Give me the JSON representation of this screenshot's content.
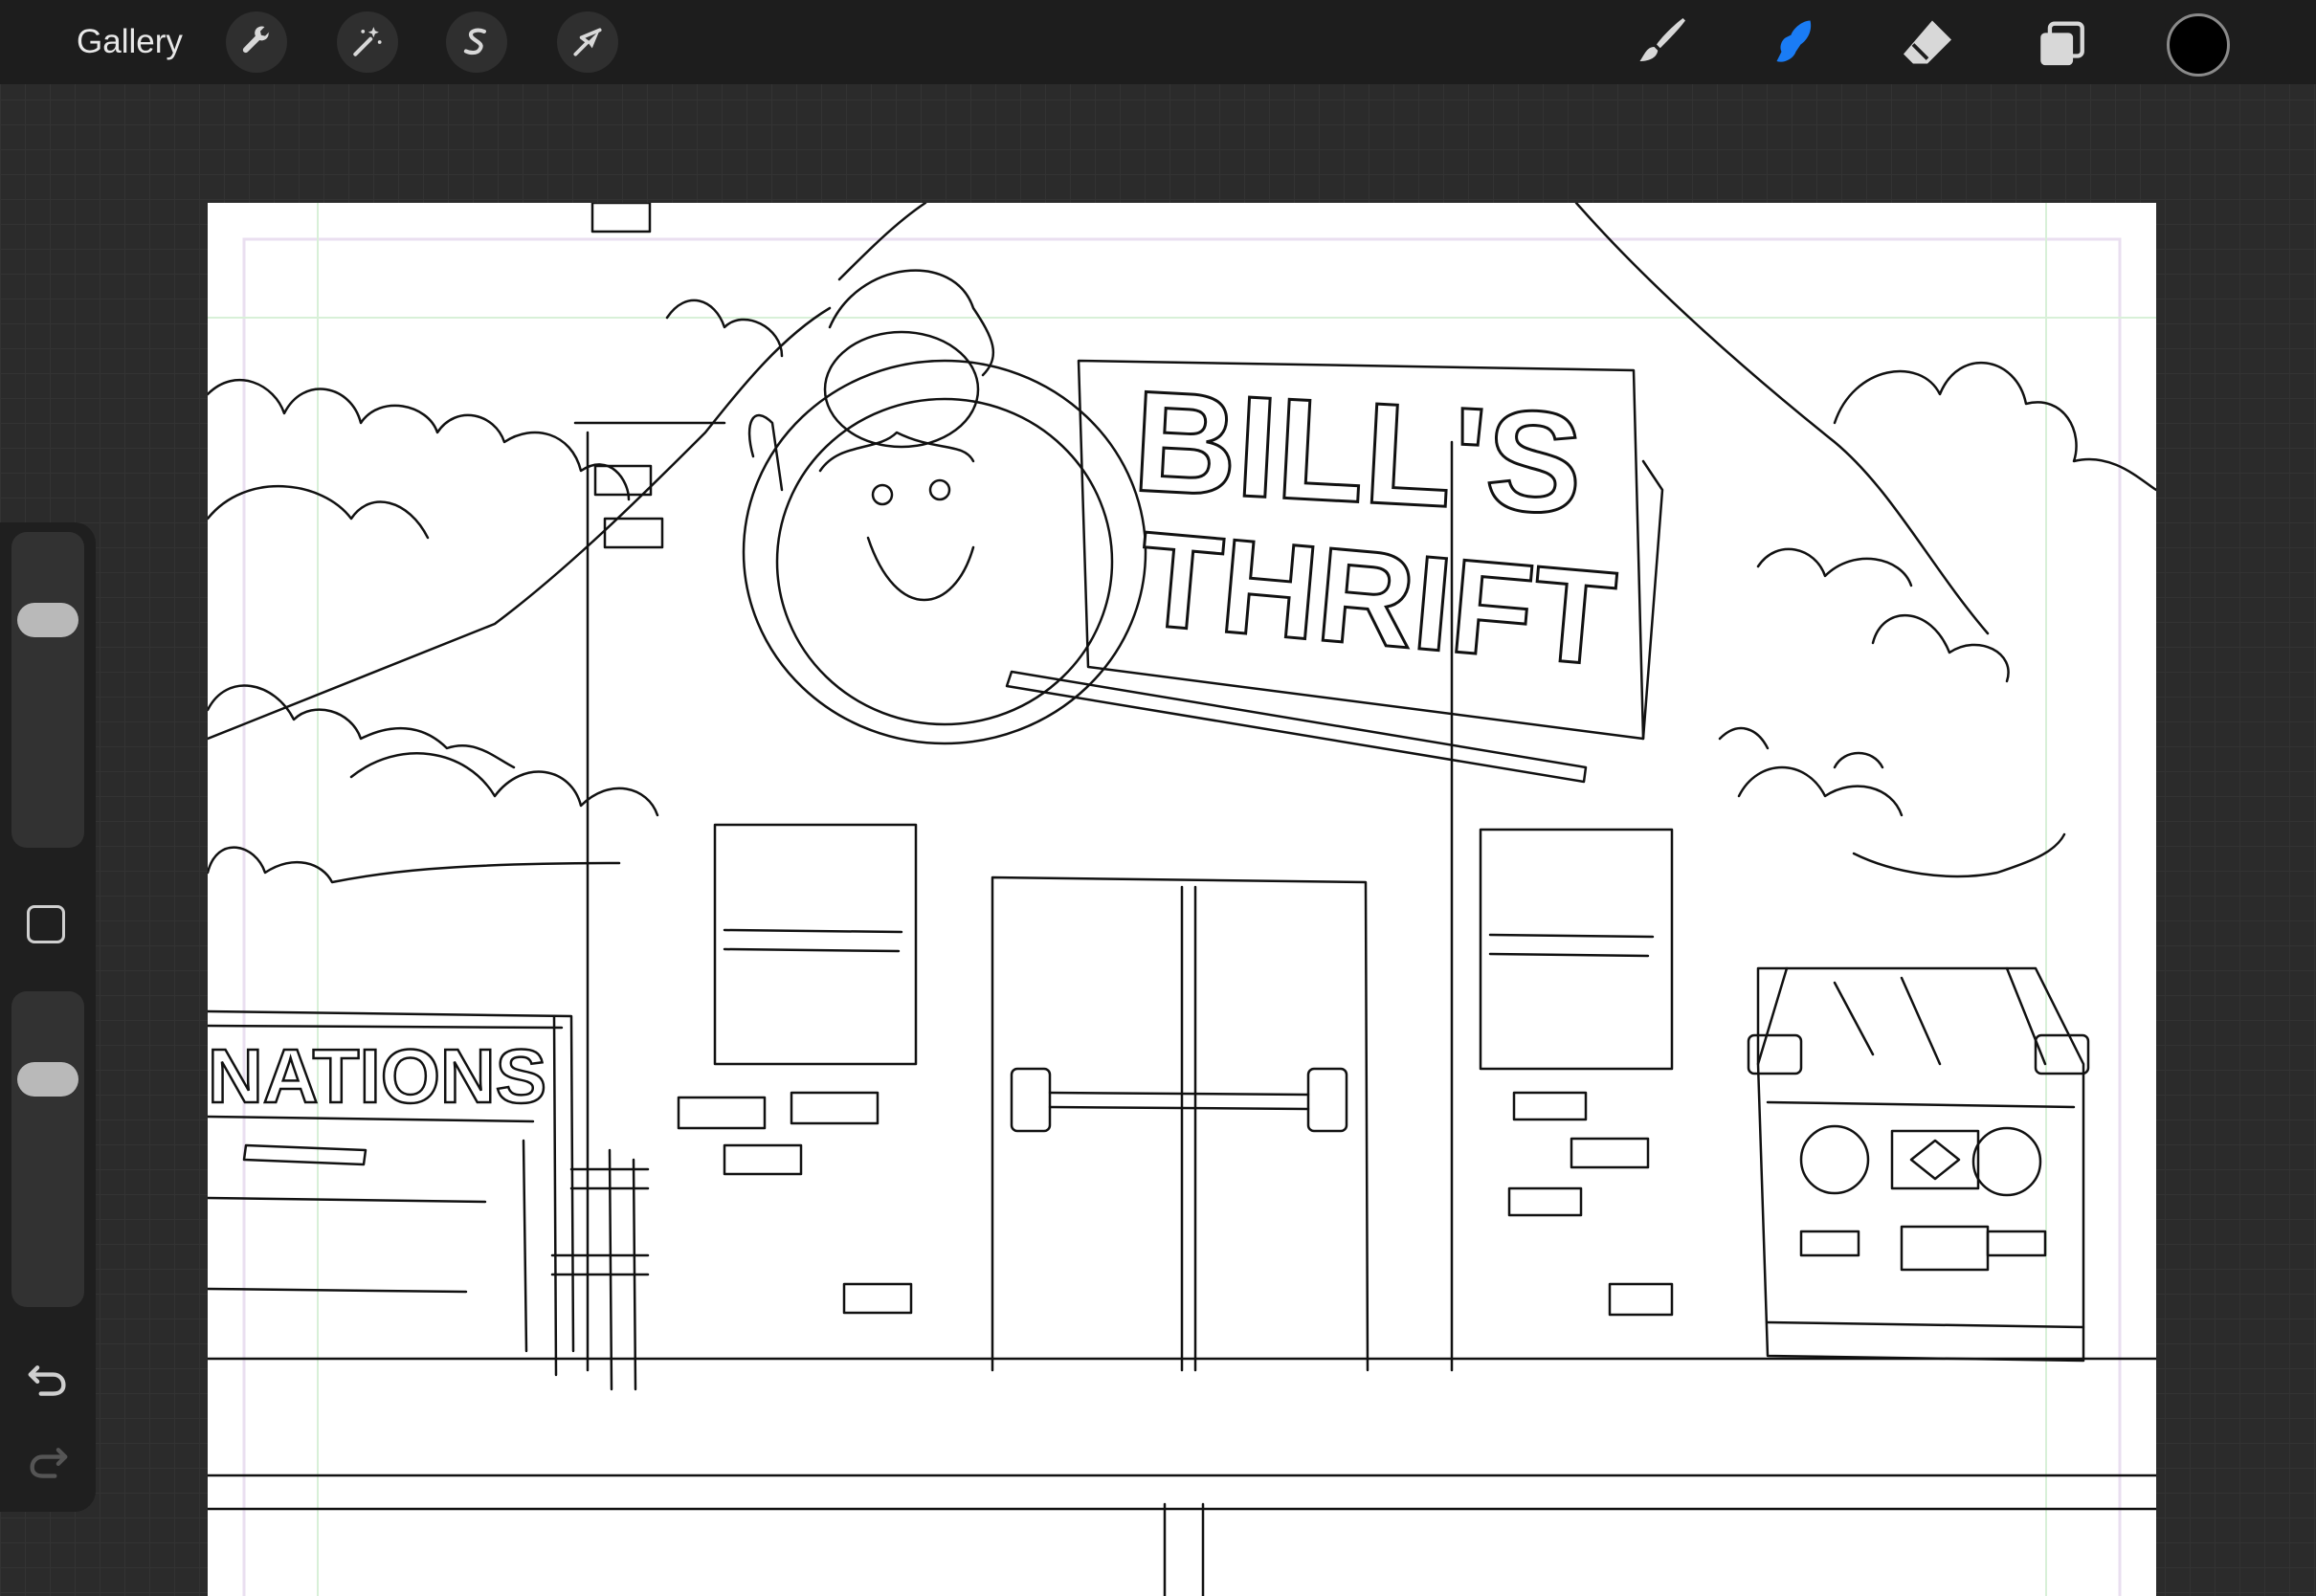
{
  "topbar": {
    "gallery_label": "Gallery",
    "left_tools": [
      {
        "icon": "wrench-icon",
        "name": "actions"
      },
      {
        "icon": "magic-wand-icon",
        "name": "adjustments"
      },
      {
        "icon": "selection-s-icon",
        "name": "selection"
      },
      {
        "icon": "arrow-cursor-icon",
        "name": "transform"
      }
    ],
    "right_tools": [
      {
        "icon": "brush-icon",
        "name": "paint"
      },
      {
        "icon": "smudge-icon",
        "name": "smudge",
        "active": true
      },
      {
        "icon": "eraser-icon",
        "name": "erase"
      },
      {
        "icon": "layers-icon",
        "name": "layers"
      }
    ],
    "active_color": "#000000",
    "accent_color": "#1a7cf5"
  },
  "canvas": {
    "sign_line1": "BILL'S",
    "sign_line2": "THRIFT",
    "side_sign": "NATIONS"
  },
  "sidebar": {
    "brush_size": 0.25,
    "brush_opacity": 0.25
  }
}
